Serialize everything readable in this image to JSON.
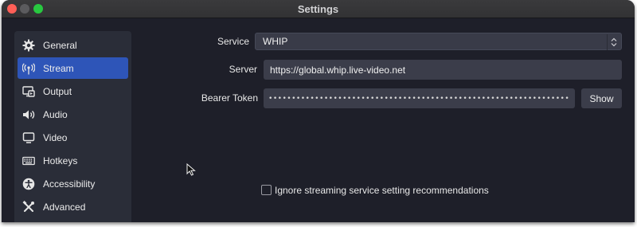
{
  "window": {
    "title": "Settings"
  },
  "sidebar": {
    "items": [
      {
        "label": "General",
        "icon": "gear-icon",
        "active": false
      },
      {
        "label": "Stream",
        "icon": "antenna-icon",
        "active": true
      },
      {
        "label": "Output",
        "icon": "output-icon",
        "active": false
      },
      {
        "label": "Audio",
        "icon": "speaker-icon",
        "active": false
      },
      {
        "label": "Video",
        "icon": "monitor-icon",
        "active": false
      },
      {
        "label": "Hotkeys",
        "icon": "keyboard-icon",
        "active": false
      },
      {
        "label": "Accessibility",
        "icon": "accessibility-icon",
        "active": false
      },
      {
        "label": "Advanced",
        "icon": "tools-icon",
        "active": false
      }
    ]
  },
  "form": {
    "service_label": "Service",
    "service_value": "WHIP",
    "server_label": "Server",
    "server_value": "https://global.whip.live-video.net",
    "token_label": "Bearer Token",
    "token_value": "••••••••••••••••••••••••••••••••••••••••••••••••••••••••••••••••••••••••••••••••••••••••••••••••••••••••",
    "show_button": "Show",
    "ignore_recommendations_label": "Ignore streaming service setting recommendations",
    "ignore_recommendations_checked": false
  },
  "colors": {
    "accent": "#2e55b8",
    "window_bg": "#1e1f29",
    "field_bg": "#3b3d4a"
  }
}
